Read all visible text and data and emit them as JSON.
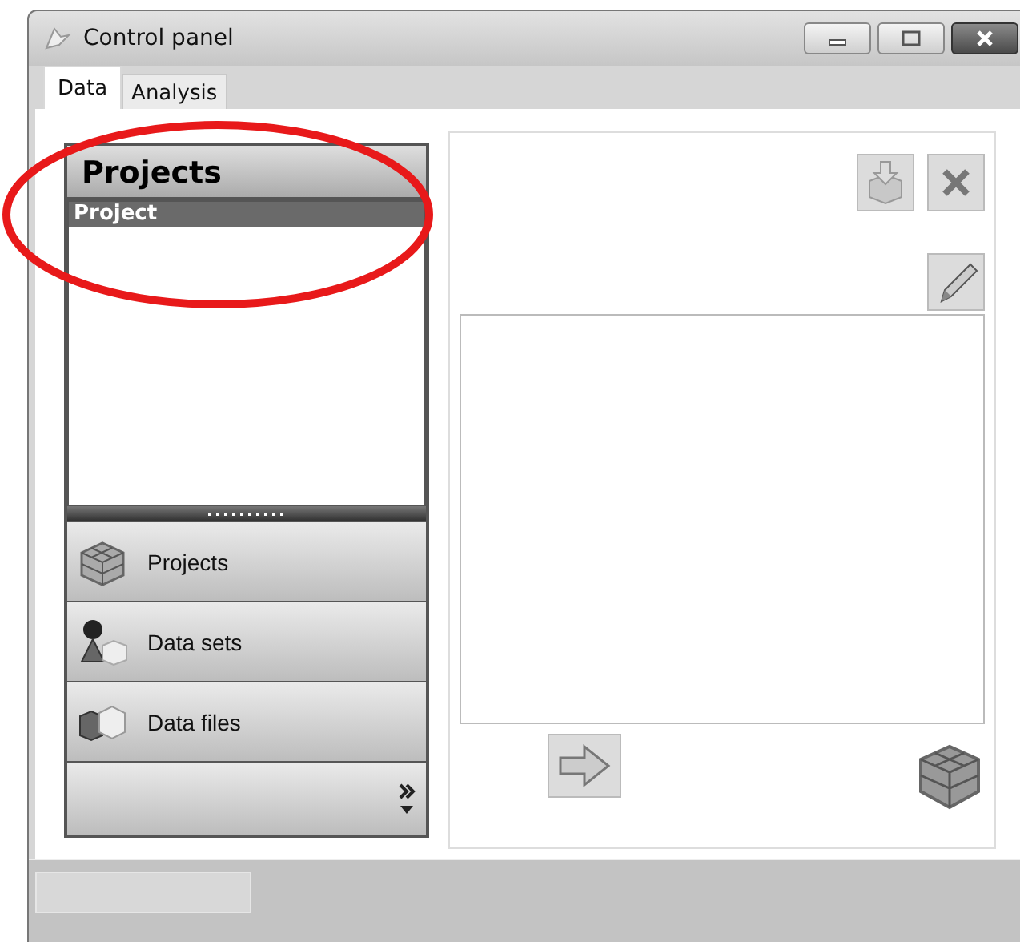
{
  "window": {
    "title": "Control panel"
  },
  "tabs": [
    {
      "label": "Data",
      "selected": true
    },
    {
      "label": "Analysis",
      "selected": false
    }
  ],
  "projects_panel": {
    "title": "Projects",
    "items": [
      {
        "label": "Project",
        "selected": true
      }
    ]
  },
  "navigation": [
    {
      "label": "Projects",
      "kind": "cube"
    },
    {
      "label": "Data sets",
      "kind": "shapes"
    },
    {
      "label": "Data files",
      "kind": "boxes"
    }
  ]
}
